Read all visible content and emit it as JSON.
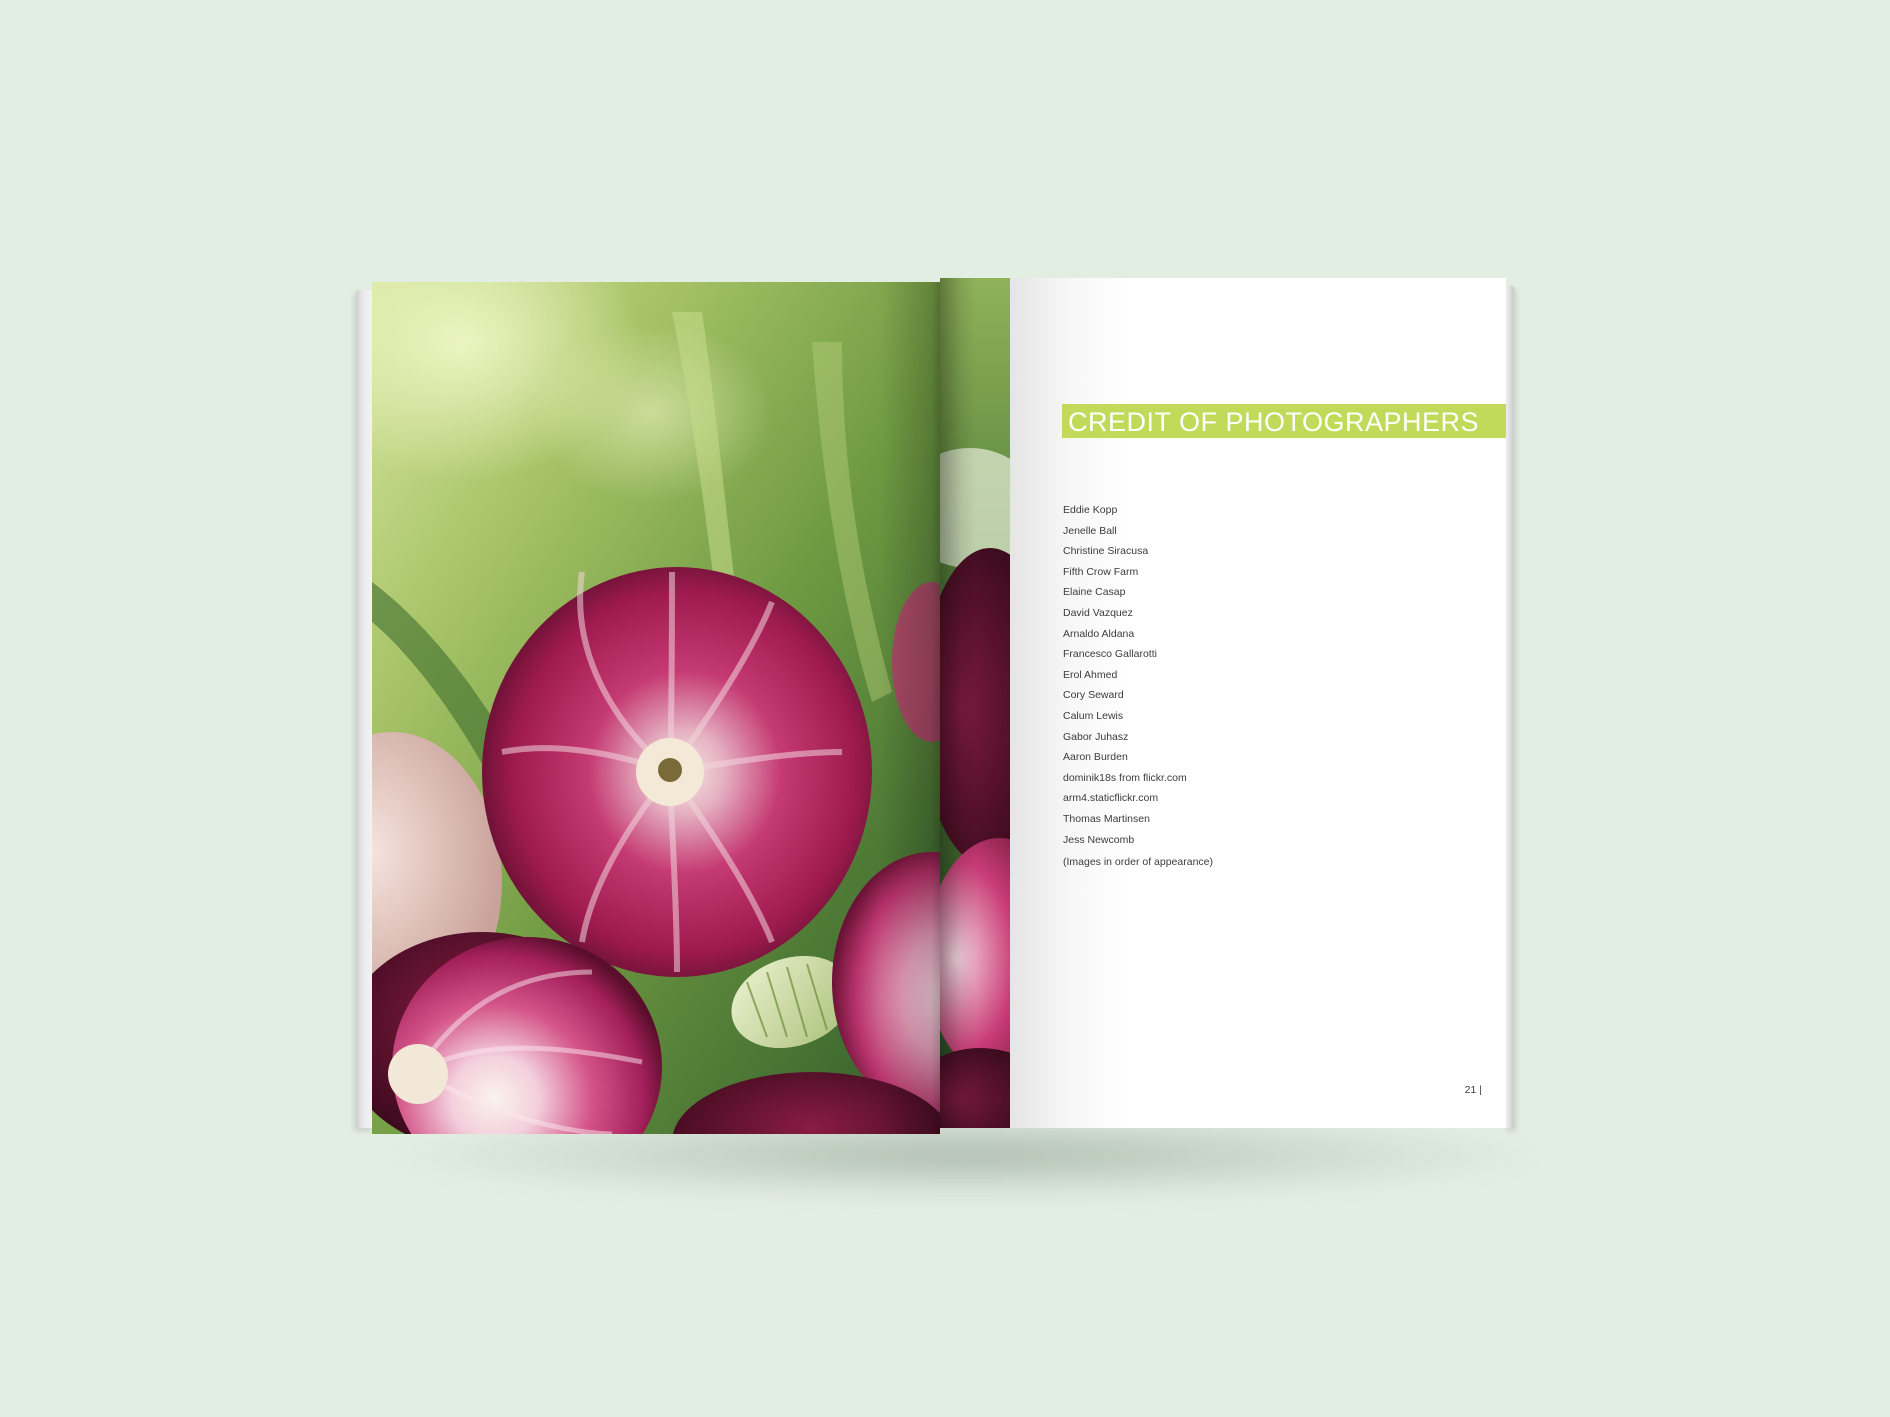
{
  "spread": {
    "photo": {
      "icon": "red-onions-photo",
      "colors": {
        "onion_magenta": "#b51f5c",
        "onion_light": "#f0d7dc",
        "leaf_green": "#7aa24a",
        "bokeh_light": "#d9e8a6"
      }
    },
    "credits_page": {
      "heading": "CREDIT OF PHOTOGRAPHERS",
      "heading_band_color": "#c3d95a",
      "photographers": [
        "Eddie Kopp",
        "Jenelle Ball",
        "Christine Siracusa",
        "Fifth Crow Farm",
        "Elaine Casap",
        "David Vazquez",
        "Arnaldo Aldana",
        "Francesco Gallarotti",
        "Erol Ahmed",
        "Cory Seward",
        "Calum Lewis",
        "Gabor Juhasz",
        "Aaron Burden",
        "dominik18s from flickr.com",
        "arm4.staticflickr.com",
        "Thomas Martinsen",
        "Jess Newcomb"
      ],
      "note": "(Images in order of appearance)",
      "page_number": "21 |"
    },
    "background_color": "#e3eee3"
  }
}
